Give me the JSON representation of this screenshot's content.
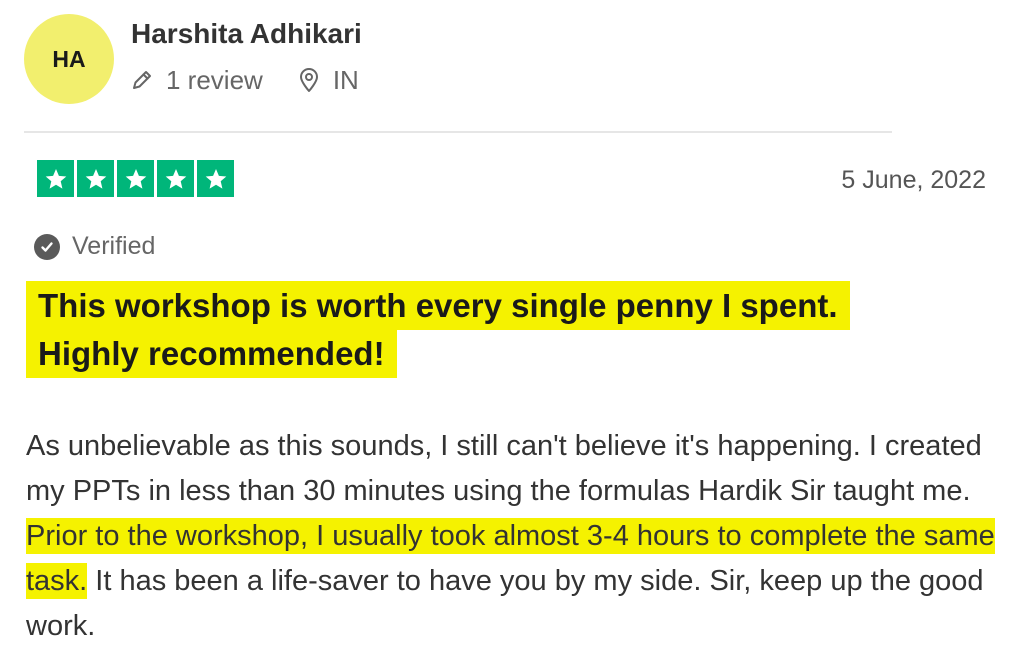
{
  "reviewer": {
    "initials": "HA",
    "name": "Harshita Adhikari",
    "review_count": "1 review",
    "country": "IN",
    "avatar_color": "#f2ef6e"
  },
  "review": {
    "rating": 5,
    "rating_max": 5,
    "star_color": "#00b67a",
    "date": "5 June, 2022",
    "verified_label": "Verified",
    "title": "This workshop is worth every single penny I spent. Highly recommended!",
    "body": {
      "part1": "As unbelievable as this sounds, I still can't believe it's happening. I created my PPTs in less than 30 minutes using the formulas Hardik Sir taught me. ",
      "highlight": "Prior to the workshop, I usually took almost 3-4 hours to complete the same task.",
      "part2": " It has been a life-saver to have you by my side. Sir, keep up the good work."
    },
    "highlight_color": "#f5f200"
  },
  "icons": {
    "pencil": "pencil-icon",
    "location": "location-pin-icon",
    "star": "star-icon",
    "verified": "verified-check-icon"
  }
}
